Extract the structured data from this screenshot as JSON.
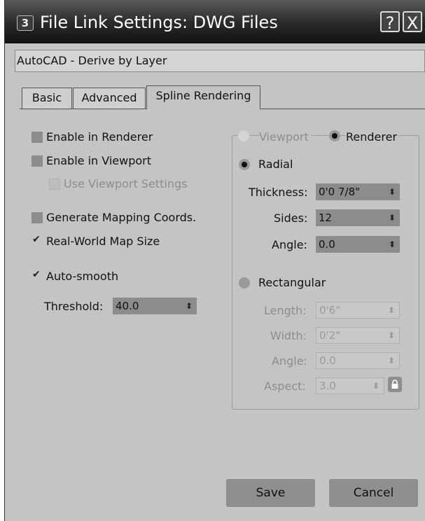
{
  "window": {
    "title": "File Link Settings: DWG Files",
    "app_icon_label": "3",
    "help_glyph": "?",
    "close_glyph": "X"
  },
  "preset": {
    "value": "AutoCAD - Derive by Layer"
  },
  "tabs": [
    {
      "label": "Basic"
    },
    {
      "label": "Advanced"
    },
    {
      "label": "Spline Rendering",
      "active": true
    }
  ],
  "options": {
    "enable_in_renderer": {
      "label": "Enable in Renderer",
      "checked": false
    },
    "enable_in_viewport": {
      "label": "Enable in Viewport",
      "checked": false
    },
    "use_viewport_settings": {
      "label": "Use Viewport Settings",
      "checked": false,
      "enabled": false
    },
    "generate_mapping": {
      "label": "Generate Mapping Coords.",
      "checked": false
    },
    "real_world_map": {
      "label": "Real-World Map Size",
      "checked": true
    },
    "auto_smooth": {
      "label": "Auto-smooth",
      "checked": true
    },
    "threshold": {
      "label": "Threshold:",
      "value": "40.0"
    }
  },
  "render_mode": {
    "viewport_label": "Viewport",
    "renderer_label": "Renderer",
    "selected": "Renderer"
  },
  "radial": {
    "label": "Radial",
    "selected": true,
    "thickness": {
      "label": "Thickness:",
      "value": "0'0 7/8\""
    },
    "sides": {
      "label": "Sides:",
      "value": "12"
    },
    "angle": {
      "label": "Angle:",
      "value": "0.0"
    }
  },
  "rectangular": {
    "label": "Rectangular",
    "selected": false,
    "length": {
      "label": "Length:",
      "value": "0'6\""
    },
    "width": {
      "label": "Width:",
      "value": "0'2\""
    },
    "angle": {
      "label": "Angle:",
      "value": "0.0"
    },
    "aspect": {
      "label": "Aspect:",
      "value": "3.0"
    }
  },
  "buttons": {
    "save": "Save",
    "cancel": "Cancel"
  },
  "spinner_glyph": "⬍"
}
